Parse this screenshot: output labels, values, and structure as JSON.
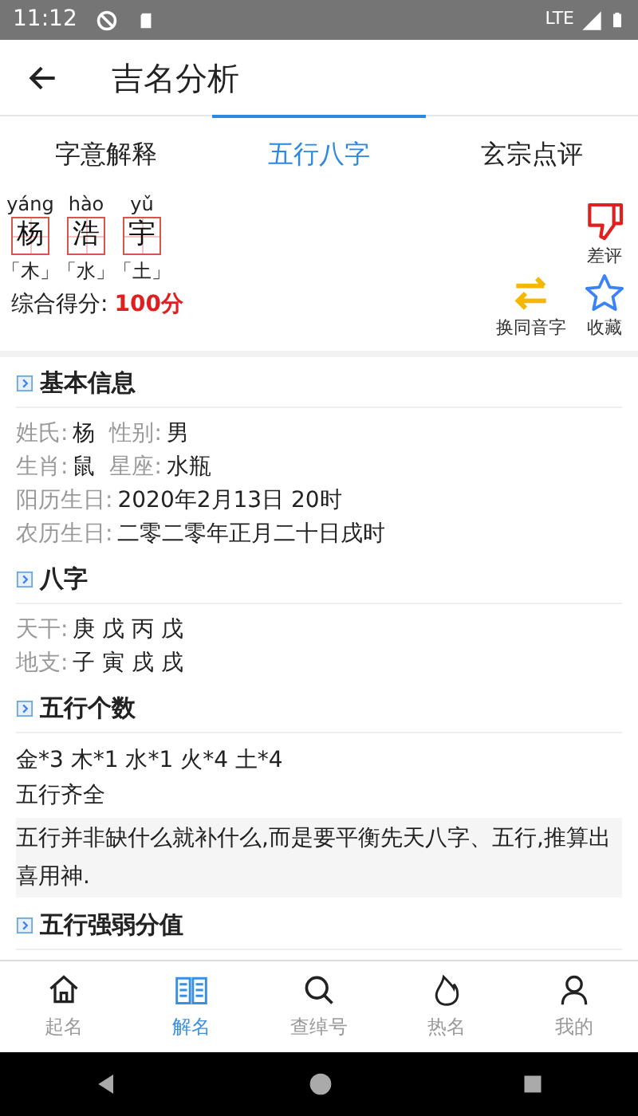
{
  "status_bar": {
    "time": "11:12",
    "network": "LTE"
  },
  "app_bar": {
    "title": "吉名分析"
  },
  "tabs": [
    {
      "label": "字意解释",
      "selected": false
    },
    {
      "label": "五行八字",
      "selected": true
    },
    {
      "label": "玄宗点评",
      "selected": false
    }
  ],
  "name_chars": [
    {
      "pinyin": "yáng",
      "char": "杨",
      "element": "「木」"
    },
    {
      "pinyin": "hào",
      "char": "浩",
      "element": "「水」"
    },
    {
      "pinyin": "yǔ",
      "char": "宇",
      "element": "「土」"
    }
  ],
  "score": {
    "label": "综合得分:",
    "value": "100分"
  },
  "actions": [
    {
      "kind": "swap",
      "label": "换同音字"
    },
    {
      "kind": "dislike",
      "label": "差评"
    },
    {
      "kind": "favorite",
      "label": "收藏"
    }
  ],
  "sections": [
    {
      "title": "基本信息",
      "kind": "fields",
      "rows": [
        [
          {
            "label": "姓氏:",
            "value": "杨"
          },
          {
            "label": "性别:",
            "value": "男"
          }
        ],
        [
          {
            "label": "生肖:",
            "value": "鼠"
          },
          {
            "label": "星座:",
            "value": "水瓶"
          }
        ],
        [
          {
            "label": "阳历生日:",
            "value": "2020年2月13日 20时"
          }
        ],
        [
          {
            "label": "农历生日:",
            "value": "二零二零年正月二十日戌时"
          }
        ]
      ]
    },
    {
      "title": "八字",
      "kind": "fields",
      "rows": [
        [
          {
            "label": "天干:",
            "value": "庚 戊 丙 戊"
          }
        ],
        [
          {
            "label": "地支:",
            "value": "子 寅 戌 戌"
          }
        ]
      ]
    },
    {
      "title": "五行个数",
      "kind": "text",
      "lines": [
        "金*3 木*1 水*1 火*4 土*4",
        "五行齐全"
      ],
      "note": "五行并非缺什么就补什么,而是要平衡先天八字、五行,推算出喜用神."
    },
    {
      "title": "五行强弱分值",
      "kind": "text"
    }
  ],
  "bottom_nav": [
    {
      "label": "起名",
      "selected": false
    },
    {
      "label": "解名",
      "selected": true
    },
    {
      "label": "查绰号",
      "selected": false
    },
    {
      "label": "热名",
      "selected": false
    },
    {
      "label": "我的",
      "selected": false
    }
  ]
}
